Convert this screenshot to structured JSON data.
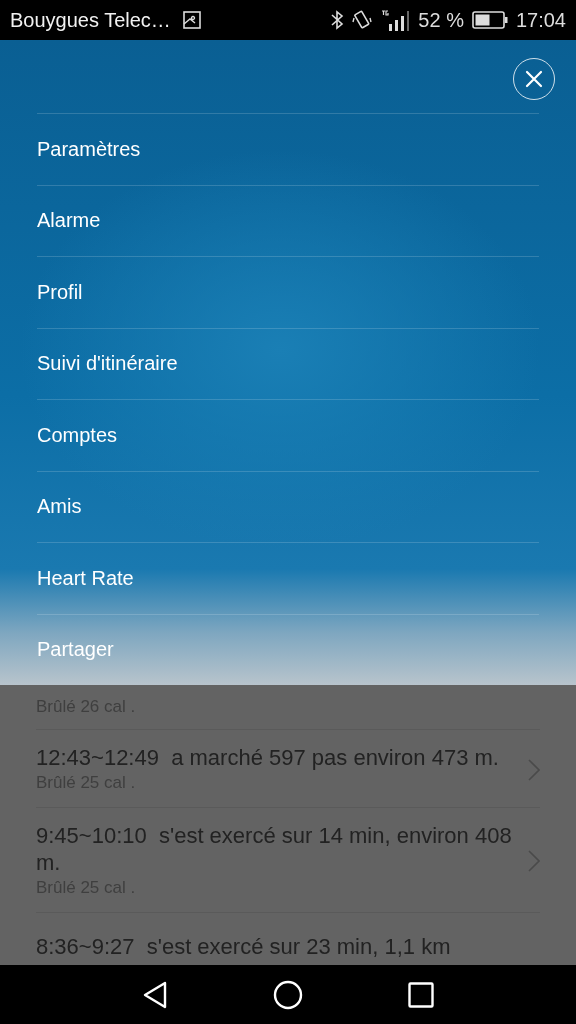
{
  "status_bar": {
    "carrier": "Bouygues Telec…",
    "battery": "52 %",
    "time": "17:04"
  },
  "menu": {
    "items": [
      {
        "label": "Paramètres"
      },
      {
        "label": "Alarme"
      },
      {
        "label": "Profil"
      },
      {
        "label": "Suivi d'itinéraire"
      },
      {
        "label": "Comptes"
      },
      {
        "label": "Amis"
      },
      {
        "label": "Heart Rate"
      },
      {
        "label": "Partager"
      }
    ]
  },
  "activities": [
    {
      "calories": "Brûlé 26 cal ."
    },
    {
      "title": "12:43~12:49  a marché 597 pas environ 473 m.",
      "calories": "Brûlé 25 cal ."
    },
    {
      "title": "9:45~10:10  s'est exercé sur 14 min, environ 408 m.",
      "calories": "Brûlé 25 cal ."
    },
    {
      "title": "8:36~9:27  s'est exercé sur 23 min, 1,1 km"
    }
  ]
}
